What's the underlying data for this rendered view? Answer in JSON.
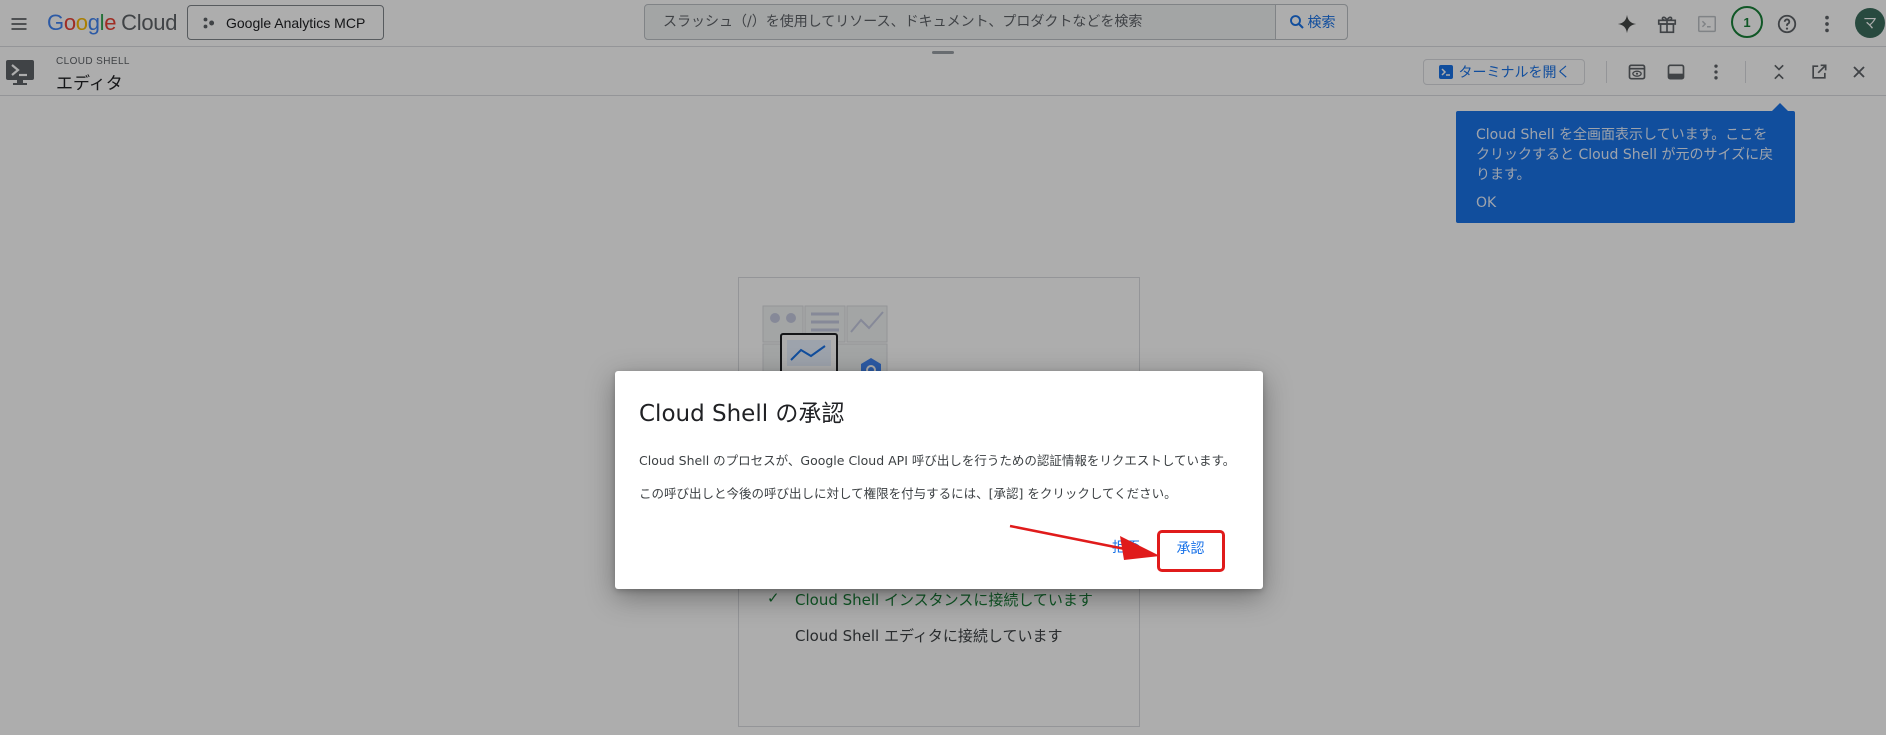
{
  "topbar": {
    "logo_letters": [
      "G",
      "o",
      "o",
      "g",
      "l",
      "e"
    ],
    "logo_cloud": "Cloud",
    "project_name": "Google Analytics MCP",
    "search_placeholder": "スラッシュ（/）を使用してリソース、ドキュメント、プロダクトなどを検索",
    "search_button": "検索",
    "notification_count": "1",
    "avatar_initial": "マ"
  },
  "shell": {
    "label": "CLOUD SHELL",
    "title": "エディタ",
    "open_terminal": "ターミナルを開く"
  },
  "tooltip": {
    "text": "Cloud Shell を全画面表示しています。ここをクリックすると Cloud Shell が元のサイズに戻ります。",
    "ok": "OK"
  },
  "loading": {
    "steps": [
      {
        "label": "Cloud Shell インスタンスに接続しています",
        "status": "done"
      },
      {
        "label": "Cloud Shell エディタに接続しています",
        "status": "pending"
      }
    ]
  },
  "dialog": {
    "title": "Cloud Shell の承認",
    "body1": "Cloud Shell のプロセスが、Google Cloud API 呼び出しを行うための認証情報をリクエストしています。",
    "body2": "この呼び出しと今後の呼び出しに対して権限を付与するには、[承認] をクリックしてください。",
    "reject": "拒否",
    "approve": "承認"
  },
  "colors": {
    "accent": "#1a73e8",
    "success": "#188038",
    "annotation": "#e01b1b"
  }
}
